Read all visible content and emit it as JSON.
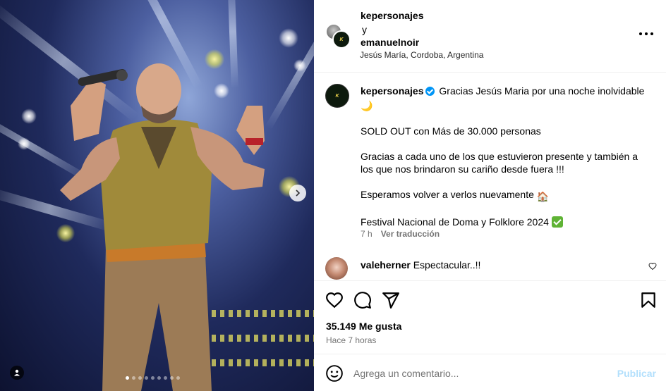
{
  "media": {
    "carousel_dots": 9,
    "active_dot": 0
  },
  "header": {
    "user1": "kepersonajes",
    "conjunction": "y",
    "user2": "emanuelnoir",
    "location": "Jesús María, Cordoba, Argentina",
    "logo_text": "K"
  },
  "caption": {
    "user": "kepersonajes",
    "line1": "Gracias Jesús Maria por una noche inolvidable",
    "moon_emoji": "🌙",
    "line2": "SOLD OUT con Más de 30.000 personas",
    "line3": "Gracias a cada uno de los que estuvieron presente y también a los que nos brindaron su cariño desde fuera !!!",
    "line4": "Esperamos volver a verlos nuevamente",
    "house_emoji": "🏠",
    "line5": "Festival Nacional de Doma y Folklore 2024",
    "time": "7 h",
    "translate": "Ver traducción"
  },
  "comment": {
    "user": "valeherner",
    "text": "Espectacular..!!"
  },
  "actions": {
    "likes": "35.149 Me gusta",
    "time_ago": "Hace 7 horas"
  },
  "comment_box": {
    "placeholder": "Agrega un comentario...",
    "publish": "Publicar"
  },
  "colors": {
    "verified": "#0095f6",
    "publish_disabled": "#b2dffc",
    "secondary_text": "#737373",
    "divider": "#efefef"
  }
}
